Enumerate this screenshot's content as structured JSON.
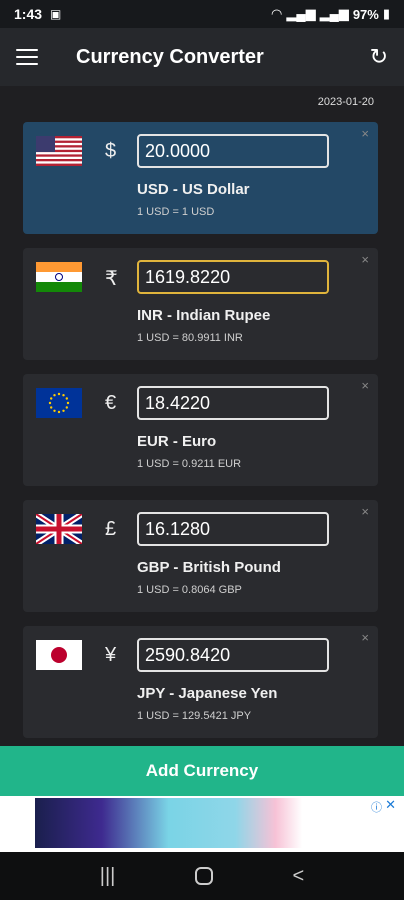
{
  "status": {
    "time": "1:43",
    "battery": "97%"
  },
  "appbar": {
    "title": "Currency Converter"
  },
  "date": "2023-01-20",
  "cards": [
    {
      "symbol": "$",
      "amount": "20.0000",
      "name": "USD - US Dollar",
      "rate": "1 USD = 1 USD"
    },
    {
      "symbol": "₹",
      "amount": "1619.8220",
      "name": "INR - Indian Rupee",
      "rate": "1 USD = 80.9911 INR"
    },
    {
      "symbol": "€",
      "amount": "18.4220",
      "name": "EUR - Euro",
      "rate": "1 USD = 0.9211 EUR"
    },
    {
      "symbol": "£",
      "amount": "16.1280",
      "name": "GBP - British Pound",
      "rate": "1 USD = 0.8064 GBP"
    },
    {
      "symbol": "¥",
      "amount": "2590.8420",
      "name": "JPY - Japanese Yen",
      "rate": "1 USD = 129.5421 JPY"
    }
  ],
  "add_button": "Add Currency",
  "icons": {
    "close": "×",
    "refresh": "↻",
    "ad_close": "✕",
    "ad_info": "ⓘ"
  },
  "colors": {
    "accent": "#21b58a",
    "selected_card": "#234866",
    "active_border": "#e0b43c"
  }
}
